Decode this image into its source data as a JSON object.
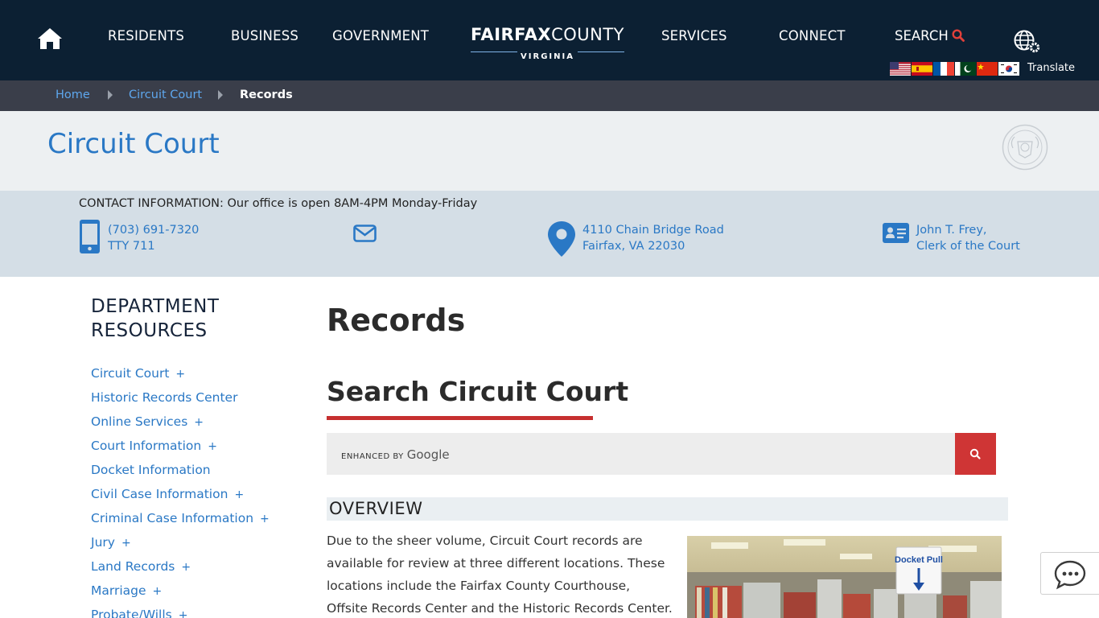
{
  "nav": {
    "items": [
      "RESIDENTS",
      "BUSINESS",
      "GOVERNMENT",
      "SERVICES",
      "CONNECT"
    ],
    "logo_bold": "FAIRFAX",
    "logo_light": "COUNTY",
    "logo_sub": "VIRGINIA",
    "search_label": "SEARCH",
    "translate_label": "Translate",
    "icons": [
      "home-icon",
      "search-icon",
      "globe-gear-icon"
    ],
    "flags": [
      "us-flag",
      "spain-flag",
      "france-flag",
      "pakistan-flag",
      "china-flag",
      "korea-flag"
    ],
    "colors": {
      "background": "#0c2033",
      "search_icon": "#e0403a"
    }
  },
  "breadcrumb": {
    "items": [
      "Home",
      "Circuit Court",
      "Records"
    ]
  },
  "department": {
    "title": "Circuit Court",
    "logo": "county-seal"
  },
  "contact": {
    "title": "CONTACT INFORMATION: Our office is open 8AM-4PM Monday-Friday",
    "phone_line1": "(703) 691-7320",
    "phone_line2": "TTY 711",
    "address_line1": "4110 Chain Bridge Road",
    "address_line2": "Fairfax, VA 22030",
    "clerk_line1": "John T. Frey,",
    "clerk_line2": "Clerk of the Court",
    "icons": [
      "phone-icon",
      "email-icon",
      "map-pin-icon",
      "id-card-icon"
    ]
  },
  "sidebar": {
    "heading_line1": "DEPARTMENT",
    "heading_line2": "RESOURCES",
    "items": [
      {
        "label": "Circuit Court",
        "expand": "+"
      },
      {
        "label": "Historic Records Center",
        "expand": ""
      },
      {
        "label": "Online Services",
        "expand": "+"
      },
      {
        "label": "Court Information",
        "expand": "+"
      },
      {
        "label": "Docket Information",
        "expand": ""
      },
      {
        "label": "Civil Case Information",
        "expand": "+"
      },
      {
        "label": "Criminal Case Information",
        "expand": "+"
      },
      {
        "label": "Jury",
        "expand": "+"
      },
      {
        "label": "Land Records",
        "expand": "+"
      },
      {
        "label": "Marriage",
        "expand": "+"
      },
      {
        "label": "Probate/Wills",
        "expand": "+"
      }
    ]
  },
  "main": {
    "page_title": "Records",
    "section_title": "Search Circuit Court",
    "search_brand_prefix": "ENHANCED BY",
    "search_brand_name": "Google",
    "overview_label": "OVERVIEW",
    "overview_text": "Due to the sheer volume, Circuit Court records are available for review at three different locations. These locations include the Fairfax County Courthouse, Offsite Records Center and the Historic Records Center.",
    "photo_sign": "Docket Pull",
    "accent_color": "#c62f2f"
  },
  "chat": {
    "icon": "chat-bubble-icon"
  }
}
